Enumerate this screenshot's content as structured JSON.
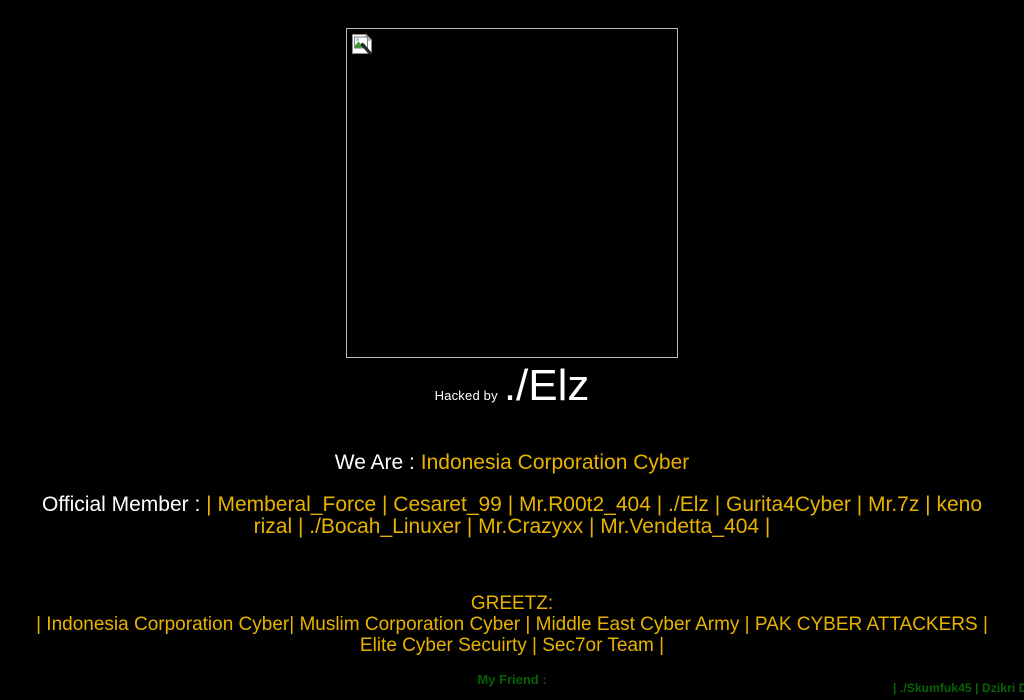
{
  "page": {
    "background_color": "#000000",
    "accent_gold": "#e8b200",
    "accent_green": "#056405",
    "text_white": "#ffffff"
  },
  "hero": {
    "image_alt": "",
    "image_state": "broken-image-placeholder",
    "icon_name": "broken-image-icon"
  },
  "headline": {
    "prefix": "Hacked by",
    "nickname": "./Elz"
  },
  "we_are": {
    "label": "We Are :",
    "group": "Indonesia Corporation Cyber"
  },
  "official_member": {
    "label": "Official Member :",
    "list": "| Memberal_Force | Cesaret_99 | Mr.R00t2_404 | ./Elz | Gurita4Cyber | Mr.7z | keno rizal | ./Bocah_Linuxer | Mr.Crazyxx | Mr.Vendetta_404 |"
  },
  "greetz": {
    "title": "GREETZ:",
    "list": "| Indonesia Corporation Cyber| Muslim Corporation Cyber | Middle East Cyber Army | PAK CYBER ATTACKERS | Elite Cyber Secuirty | Sec7or Team |"
  },
  "my_friend": {
    "label": "My Friend :",
    "list": "| ./Skumfuk45 | Dzikri D"
  }
}
